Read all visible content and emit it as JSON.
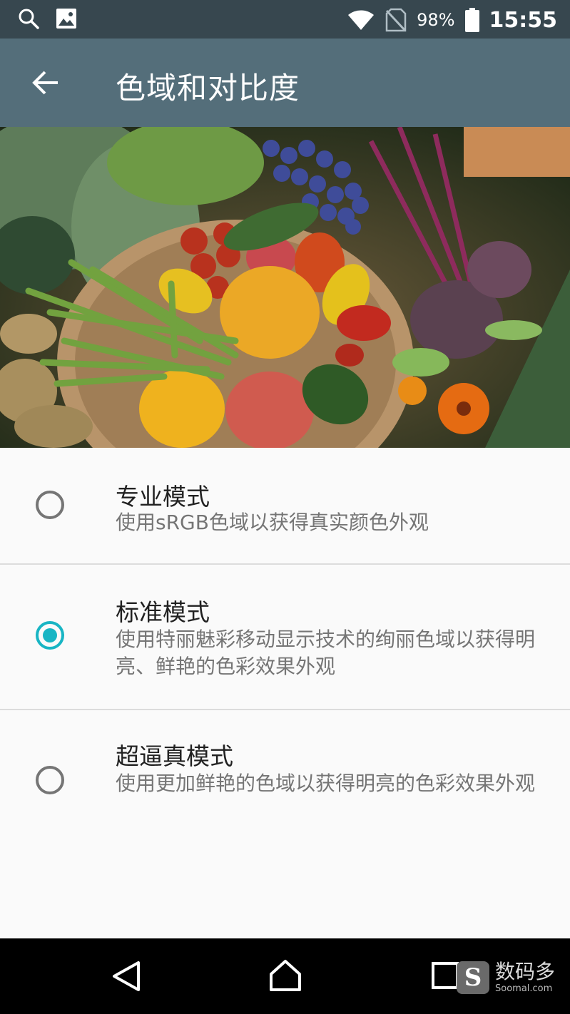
{
  "status_bar": {
    "battery_percent": "98%",
    "time": "15:55",
    "icons": [
      "search-icon",
      "image-icon",
      "wifi-icon",
      "no-sim-icon",
      "battery-icon"
    ]
  },
  "toolbar": {
    "title": "色域和对比度",
    "back_icon": "arrow-back-icon"
  },
  "hero": {
    "image": "vegetables-basket-photo"
  },
  "options": [
    {
      "title": "专业模式",
      "description": "使用sRGB色域以获得真实颜色外观",
      "selected": false
    },
    {
      "title": "标准模式",
      "description": "使用特丽魅彩移动显示技术的绚丽色域以获得明亮、鲜艳的色彩效果外观",
      "selected": true
    },
    {
      "title": "超逼真模式",
      "description": "使用更加鲜艳的色域以获得明亮的色彩效果外观",
      "selected": false
    }
  ],
  "nav_bar": {
    "icons": [
      "nav-back-icon",
      "nav-home-icon",
      "nav-recents-icon"
    ]
  },
  "watermark": {
    "logo_letter": "S",
    "name": "数码多",
    "url": "Soomal.com"
  },
  "colors": {
    "status_bar": "#37474f",
    "toolbar": "#546e7a",
    "accent": "#18b5c4",
    "background": "#fafafa"
  }
}
